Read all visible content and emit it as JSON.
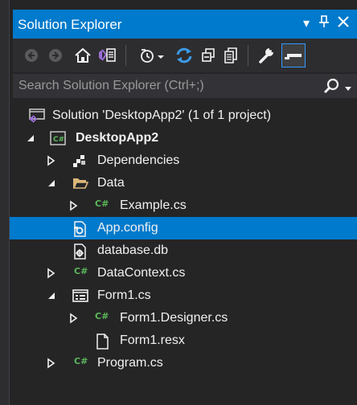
{
  "window": {
    "title": "Solution Explorer",
    "menu_glyph": "▾",
    "pin_glyph": "⊥",
    "close_glyph": "✕"
  },
  "search": {
    "placeholder": "Search Solution Explorer (Ctrl+;)"
  },
  "tree": {
    "solution": "Solution 'DesktopApp2' (1 of 1 project)",
    "project": "DesktopApp2",
    "dependencies": "Dependencies",
    "data_folder": "Data",
    "example_cs": "Example.cs",
    "app_config": "App.config",
    "database_db": "database.db",
    "datacontext_cs": "DataContext.cs",
    "form1_cs": "Form1.cs",
    "form1_designer_cs": "Form1.Designer.cs",
    "form1_resx": "Form1.resx",
    "program_cs": "Program.cs",
    "cs_badge": "C#"
  },
  "colors": {
    "accent": "#007acc",
    "background": "#252526",
    "csharp_green": "#5cb85c",
    "folder": "#dcb67a"
  }
}
